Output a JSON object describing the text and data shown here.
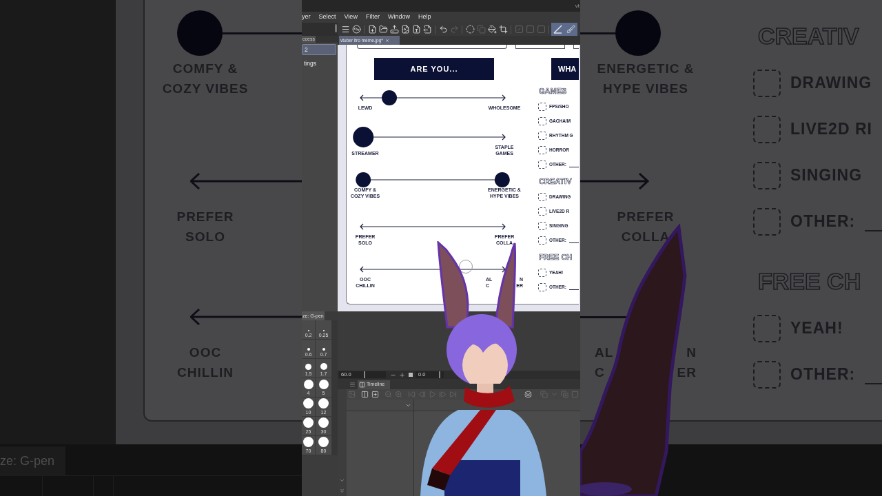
{
  "backdrop_left": {
    "rows": [
      {
        "kind": "dot",
        "label": [
          [
            "COMFY &"
          ],
          [
            "COZY VIBES"
          ]
        ]
      },
      {
        "kind": "arrow",
        "label": [
          [
            "PREFER"
          ],
          [
            "SOLO"
          ]
        ]
      },
      {
        "kind": "arrow",
        "label": [
          [
            "OOC"
          ],
          [
            "CHILLIN"
          ]
        ]
      }
    ],
    "panel_tab": "ze: G-pen"
  },
  "window": {
    "title": "vt",
    "menu": [
      "yer",
      "Select",
      "View",
      "Filter",
      "Window",
      "Help"
    ]
  },
  "quick_access": {
    "tab": "ccess",
    "items": [
      {
        "label": "2",
        "selected": true
      },
      {
        "label": "tings",
        "selected": false
      }
    ]
  },
  "brush_size": {
    "tab": "ze: G-pen",
    "sizes": [
      "0.2",
      "0.25",
      "0.6",
      "0.7",
      "1.5",
      "1.7",
      "4",
      "5",
      "10",
      "12",
      "25",
      "30",
      "70",
      "80"
    ]
  },
  "toolbar": [
    {
      "disabled": false,
      "selected": false
    },
    {
      "disabled": false,
      "selected": false
    },
    {
      "disabled": false,
      "selected": false
    },
    {
      "disabled": false,
      "selected": false
    },
    {
      "disabled": false,
      "selected": false
    },
    {
      "disabled": false,
      "selected": false
    },
    {
      "disabled": false,
      "selected": false
    },
    {
      "disabled": false,
      "selected": false
    },
    {
      "disabled": false,
      "selected": false
    },
    {
      "disabled": true,
      "selected": false
    },
    {
      "disabled": false,
      "selected": false
    },
    {
      "disabled": true,
      "selected": false
    },
    {
      "disabled": false,
      "selected": false
    },
    {
      "disabled": false,
      "selected": false
    },
    {
      "disabled": true,
      "selected": false
    },
    {
      "disabled": true,
      "selected": false
    },
    {
      "disabled": true,
      "selected": false
    },
    {
      "disabled": false,
      "selected": true
    },
    {
      "disabled": false,
      "selected": true
    }
  ],
  "document_tab": {
    "label": "vtuber itro meme.jpg*"
  },
  "worksheet": {
    "header_left": "ARE YOU...",
    "header_right": "WHA",
    "sliders": [
      {
        "left_label": [
          [
            "LEWD"
          ]
        ],
        "right_label": [
          [
            "WHOLESOME"
          ]
        ],
        "thumbs": [
          {
            "kind": "dot",
            "level": 0.2
          }
        ]
      },
      {
        "left_label": [
          [
            "STREAMER"
          ]
        ],
        "right_label": [
          [
            "STAPLE"
          ],
          [
            "GAMES"
          ]
        ],
        "thumbs": [
          {
            "kind": "blob",
            "level": 0.02
          }
        ]
      },
      {
        "left_label": [
          [
            "COMFY &"
          ],
          [
            "COZY VIBES"
          ]
        ],
        "right_label": [
          [
            "ENERGETIC &"
          ],
          [
            "HYPE VIBES"
          ]
        ],
        "thumbs": [
          {
            "kind": "dot",
            "level": 0.02
          },
          {
            "kind": "dot",
            "level": 0.98
          }
        ]
      },
      {
        "left_label": [
          [
            "PREFER"
          ],
          [
            "SOLO"
          ]
        ],
        "right_label": [
          [
            "PREFER"
          ],
          [
            "COLLA"
          ]
        ]
      },
      {
        "left_label": [
          [
            "OOC"
          ],
          [
            "CHILLIN"
          ]
        ],
        "right_label": [
          [
            "AL",
            "N"
          ],
          [
            "C",
            "ER"
          ]
        ]
      }
    ],
    "sections": [
      {
        "title": "GAMES",
        "items": [
          {
            "label": "FPS/SHO",
            "checked": false,
            "kind": "plain"
          },
          {
            "label": "GACHA/M",
            "checked": false,
            "kind": "plain"
          },
          {
            "label": "RHYTHM G",
            "checked": false,
            "kind": "plain"
          },
          {
            "label": "HORROR",
            "checked": false,
            "kind": "plain"
          },
          {
            "label": "OTHER:",
            "checked": false,
            "kind": "write_in"
          }
        ]
      },
      {
        "title": "CREATIV",
        "items": [
          {
            "label": "DRAWING",
            "checked": false,
            "kind": "plain"
          },
          {
            "label": "LIVE2D R",
            "checked": false,
            "kind": "plain"
          },
          {
            "label": "SINGING",
            "checked": false,
            "kind": "plain"
          },
          {
            "label": "OTHER:",
            "checked": false,
            "kind": "write_in"
          }
        ]
      },
      {
        "title": "FREE CH",
        "items": [
          {
            "label": "YEAH!",
            "checked": false,
            "kind": "plain"
          },
          {
            "label": "OTHER:",
            "checked": false,
            "kind": "write_in"
          }
        ]
      }
    ]
  },
  "navigator": {
    "zoom": {
      "value": "60.0",
      "level": 0.53
    },
    "angle": {
      "value": "0.0",
      "level": 0.83
    }
  },
  "timeline": {
    "tab": "Timeline",
    "tools": [
      {
        "disabled": true
      },
      {
        "disabled": false
      },
      {
        "disabled": false
      },
      {
        "disabled": true
      },
      {
        "disabled": true
      },
      {
        "disabled": true
      },
      {
        "disabled": true
      },
      {
        "disabled": true
      },
      {
        "disabled": true
      },
      {
        "disabled": true
      },
      {
        "disabled": false
      },
      {
        "disabled": true
      },
      {
        "disabled": true
      },
      {
        "disabled": true
      },
      {
        "disabled": true
      }
    ]
  },
  "backdrop_right": {
    "rows": [
      {
        "kind": "dot",
        "label": [
          [
            "ENERGETIC &"
          ],
          [
            "HYPE VIBES"
          ]
        ]
      },
      {
        "kind": "arrow",
        "label": [
          [
            "PREFER"
          ],
          [
            "COLLA"
          ]
        ]
      },
      {
        "kind": "line",
        "label": [
          [
            "AL",
            "N"
          ],
          [
            "C",
            "ER"
          ]
        ]
      }
    ],
    "sections": [
      {
        "title": "CREATIV",
        "items": [
          {
            "label": "DRAWING",
            "checked": false,
            "kind": "plain"
          },
          {
            "label": "LIVE2D RI",
            "checked": false,
            "kind": "plain"
          },
          {
            "label": "SINGING",
            "checked": false,
            "kind": "plain"
          },
          {
            "label": "OTHER:",
            "checked": false,
            "kind": "write_in"
          }
        ]
      },
      {
        "title": "FREE CH",
        "items": [
          {
            "label": "YEAH!",
            "checked": false,
            "kind": "plain"
          },
          {
            "label": "OTHER:",
            "checked": false,
            "kind": "write_in"
          }
        ]
      }
    ]
  }
}
